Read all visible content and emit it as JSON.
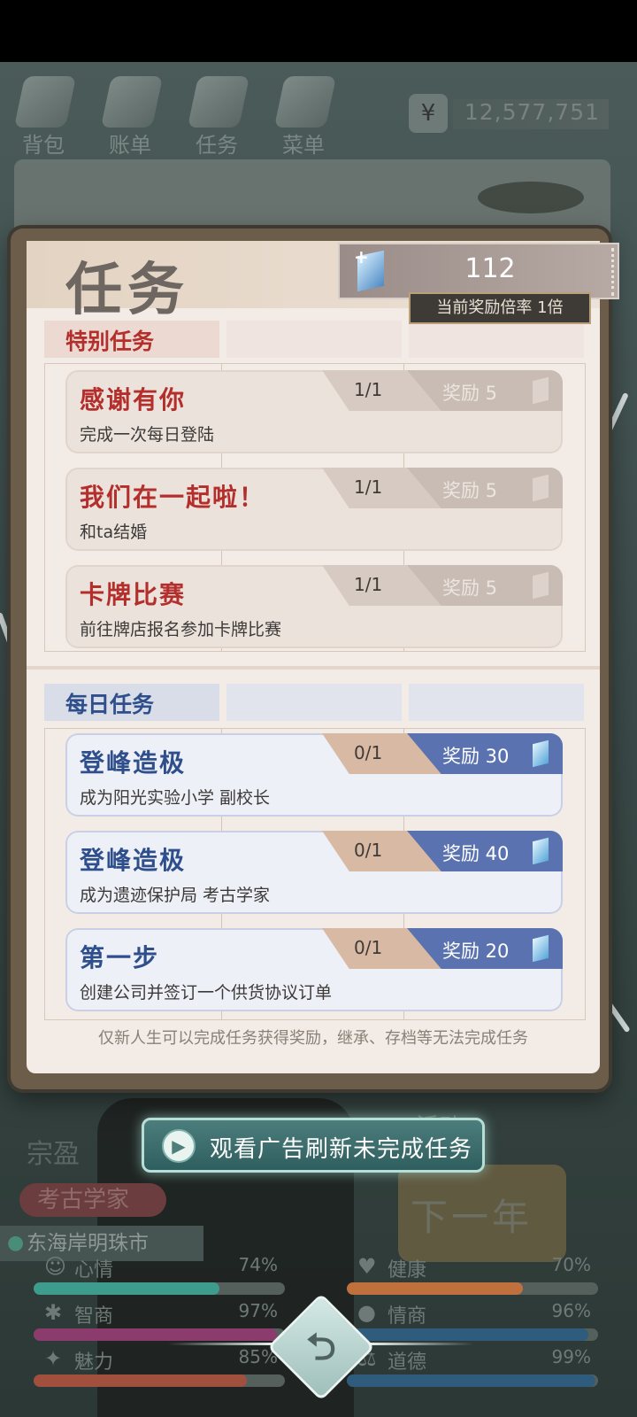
{
  "topnav": {
    "items": [
      {
        "label": "背包",
        "icon": "backpack-icon"
      },
      {
        "label": "账单",
        "icon": "bill-icon"
      },
      {
        "label": "任务",
        "icon": "task-icon"
      },
      {
        "label": "菜单",
        "icon": "menu-icon"
      }
    ],
    "money_symbol": "¥",
    "money_value": "12,577,751"
  },
  "dialog": {
    "title": "任务",
    "gem_plus": "+",
    "gem_count": "112",
    "multiplier_text": "当前奖励倍率 1倍",
    "special_section": {
      "label": "特别任务",
      "tasks": [
        {
          "title": "感谢有你",
          "desc": "完成一次每日登陆",
          "progress": "1/1",
          "reward": "奖励 5"
        },
        {
          "title": "我们在一起啦！",
          "desc": "和ta结婚",
          "progress": "1/1",
          "reward": "奖励 5"
        },
        {
          "title": "卡牌比赛",
          "desc": "前往牌店报名参加卡牌比赛",
          "progress": "1/1",
          "reward": "奖励 5"
        }
      ]
    },
    "daily_section": {
      "label": "每日任务",
      "tasks": [
        {
          "title": "登峰造极",
          "desc": "成为阳光实验小学 副校长",
          "progress": "0/1",
          "reward": "奖励 30"
        },
        {
          "title": "登峰造极",
          "desc": "成为遗迹保护局 考古学家",
          "progress": "0/1",
          "reward": "奖励 40"
        },
        {
          "title": "第一步",
          "desc": "创建公司并签订一个供货协议订单",
          "progress": "0/1",
          "reward": "奖励 20"
        }
      ]
    },
    "footer_note": "仅新人生可以完成任务获得奖励，继承、存档等无法完成任务"
  },
  "ad_button": {
    "label": "观看广告刷新未完成任务"
  },
  "background": {
    "name": "宗盈",
    "job": "考古学家",
    "location": "东海岸明珠市",
    "event_label": "活动",
    "next_year_label": "下一年",
    "stats": [
      {
        "label": "心情",
        "value": "74%",
        "fill": 0.74,
        "color": "#3e9c8c",
        "icon": "smile-icon"
      },
      {
        "label": "健康",
        "value": "70%",
        "fill": 0.7,
        "color": "#c0703c",
        "icon": "heart-icon"
      },
      {
        "label": "智商",
        "value": "97%",
        "fill": 0.97,
        "color": "#8c3c6c",
        "icon": "bulb-icon"
      },
      {
        "label": "情商",
        "value": "96%",
        "fill": 0.96,
        "color": "#2f5c7c",
        "icon": "apple-icon"
      },
      {
        "label": "魅力",
        "value": "85%",
        "fill": 0.85,
        "color": "#a0503c",
        "icon": "star-icon"
      },
      {
        "label": "道德",
        "value": "99%",
        "fill": 0.99,
        "color": "#2f5c7c",
        "icon": "scale-icon"
      }
    ]
  },
  "colors": {
    "special_title": "#b42f2b",
    "daily_title": "#2f4f8c",
    "daily_reward_tab": "#5a72b0"
  }
}
